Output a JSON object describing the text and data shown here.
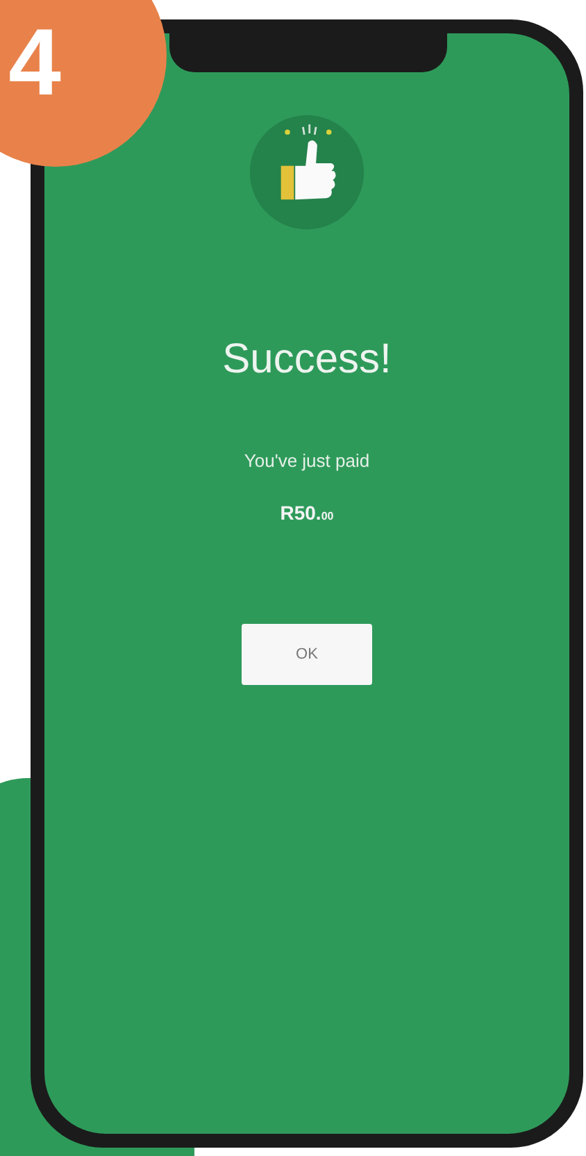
{
  "step_badge": "4",
  "screen": {
    "title": "Success!",
    "message": "You've just paid",
    "amount": "R50.$_{00}$",
    "button": "OK"
  }
}
